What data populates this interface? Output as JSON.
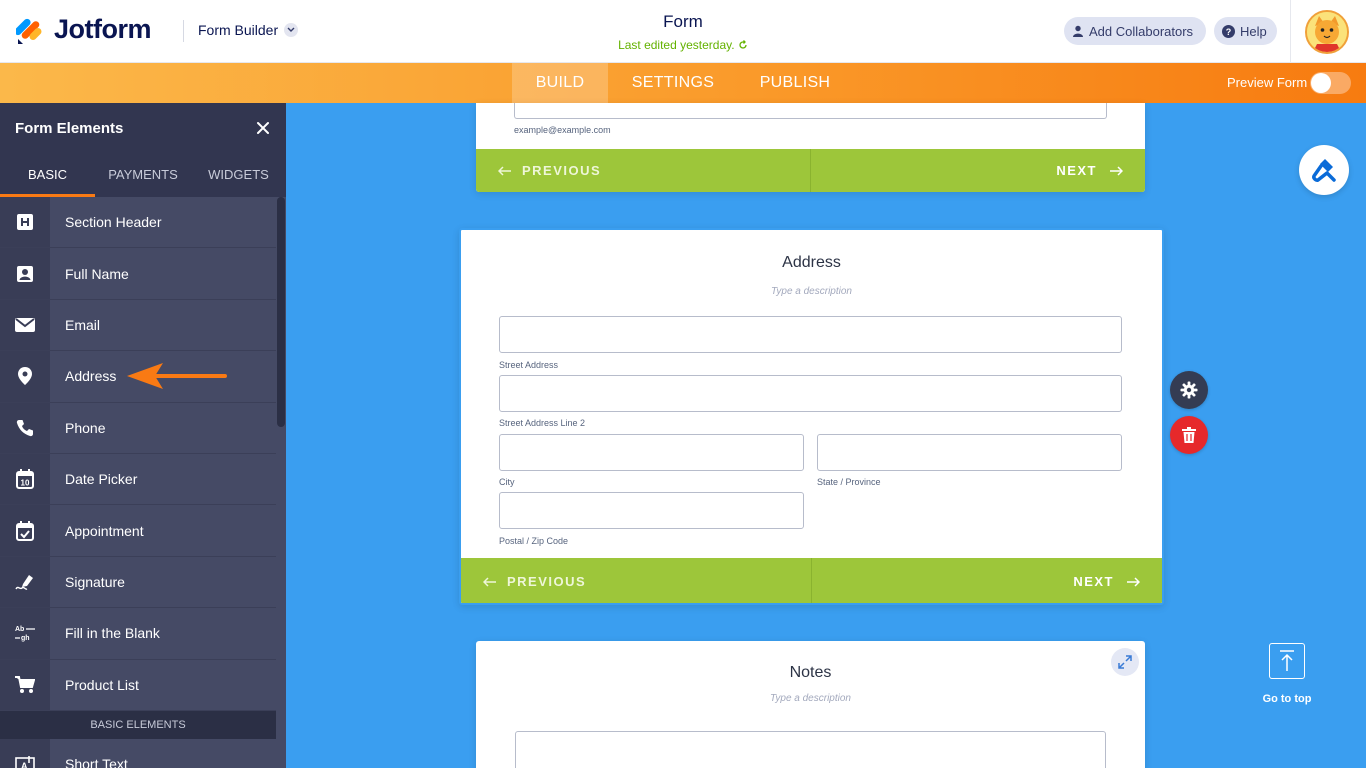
{
  "header": {
    "logo_text": "Jotform",
    "builder_menu": "Form Builder",
    "form_title": "Form",
    "last_edited": "Last edited yesterday.",
    "add_collaborators": "Add Collaborators",
    "help": "Help"
  },
  "nav": {
    "build": "BUILD",
    "settings": "SETTINGS",
    "publish": "PUBLISH",
    "preview_form": "Preview Form"
  },
  "sidebar": {
    "title": "Form Elements",
    "tabs": [
      "BASIC",
      "PAYMENTS",
      "WIDGETS"
    ],
    "items": [
      {
        "label": "Section Header",
        "icon": "section-header-icon"
      },
      {
        "label": "Full Name",
        "icon": "full-name-icon"
      },
      {
        "label": "Email",
        "icon": "email-icon"
      },
      {
        "label": "Address",
        "icon": "location-pin-icon"
      },
      {
        "label": "Phone",
        "icon": "phone-icon"
      },
      {
        "label": "Date Picker",
        "icon": "calendar-icon"
      },
      {
        "label": "Appointment",
        "icon": "appointment-icon"
      },
      {
        "label": "Signature",
        "icon": "signature-pen-icon"
      },
      {
        "label": "Fill in the Blank",
        "icon": "fill-blank-icon"
      },
      {
        "label": "Product List",
        "icon": "cart-icon"
      }
    ],
    "section_label": "BASIC ELEMENTS",
    "after_section": [
      {
        "label": "Short Text",
        "icon": "short-text-icon"
      }
    ]
  },
  "email_card": {
    "hint": "example@example.com",
    "previous": "PREVIOUS",
    "next": "NEXT"
  },
  "address_card": {
    "title": "Address",
    "description": "Type a description",
    "street": "Street Address",
    "street2": "Street Address Line 2",
    "city": "City",
    "state": "State / Province",
    "postal": "Postal / Zip Code",
    "previous": "PREVIOUS",
    "next": "NEXT"
  },
  "notes_card": {
    "title": "Notes",
    "description": "Type a description"
  },
  "go_to_top": "Go to top",
  "colors": {
    "brand_orange": "#f97a14",
    "canvas_blue": "#3a9ef0",
    "nav_green": "#9dc63a",
    "sidebar_dark": "#454a65",
    "delete_red": "#e6292b"
  }
}
